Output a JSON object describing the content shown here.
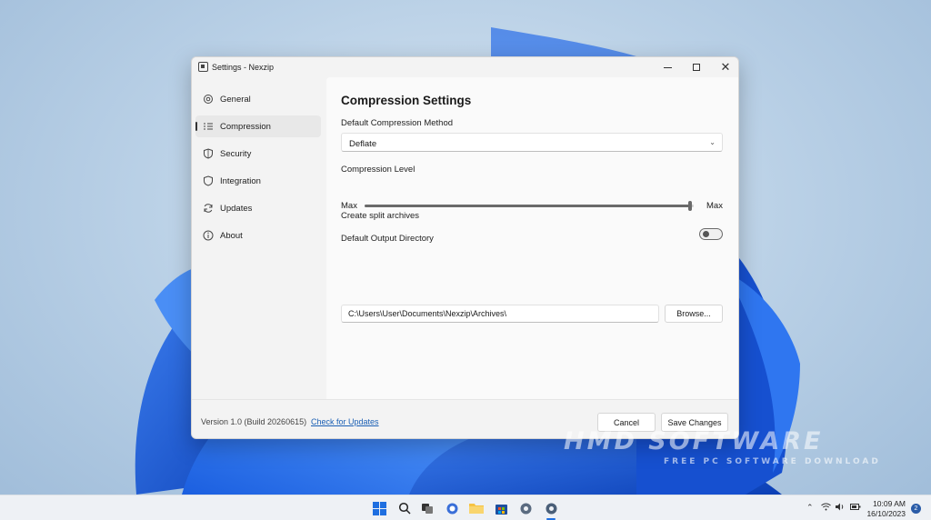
{
  "window": {
    "title": "Settings - Nexzip",
    "app_icon": "archive-icon"
  },
  "sidebar": {
    "items": [
      {
        "label": "General",
        "icon": "gear-icon"
      },
      {
        "label": "Compression",
        "icon": "list-icon",
        "active": true
      },
      {
        "label": "Security",
        "icon": "shield-icon"
      },
      {
        "label": "Integration",
        "icon": "shield-outline-icon"
      },
      {
        "label": "Updates",
        "icon": "refresh-icon"
      },
      {
        "label": "About",
        "icon": "info-icon"
      }
    ]
  },
  "main": {
    "heading": "Compression Settings",
    "method_label": "Default Compression Method",
    "method_value": "Deflate",
    "level_label": "Compression Level",
    "level_min_label": "Max",
    "level_max_label": "Max",
    "level_fraction": 0.99,
    "split_label": "Create split archives",
    "split_enabled": false,
    "output_label": "Default Output Directory",
    "output_path": "C:\\Users\\User\\Documents\\Nexzip\\Archives\\",
    "browse_label": "Browse..."
  },
  "footer": {
    "version": "Version 1.0 (Build 20260615)",
    "check_updates": "Check for Updates",
    "cancel": "Cancel",
    "save": "Save Changes"
  },
  "watermark": {
    "main": "HMD SOFTWARE",
    "sub": "FREE PC SOFTWARE DOWNLOAD"
  },
  "taskbar": {
    "time": "10:09 AM",
    "date": "16/10/2023",
    "notifications": "2"
  },
  "colors": {
    "link": "#1a5fb4",
    "accent_dark": "#6a6a6a"
  }
}
